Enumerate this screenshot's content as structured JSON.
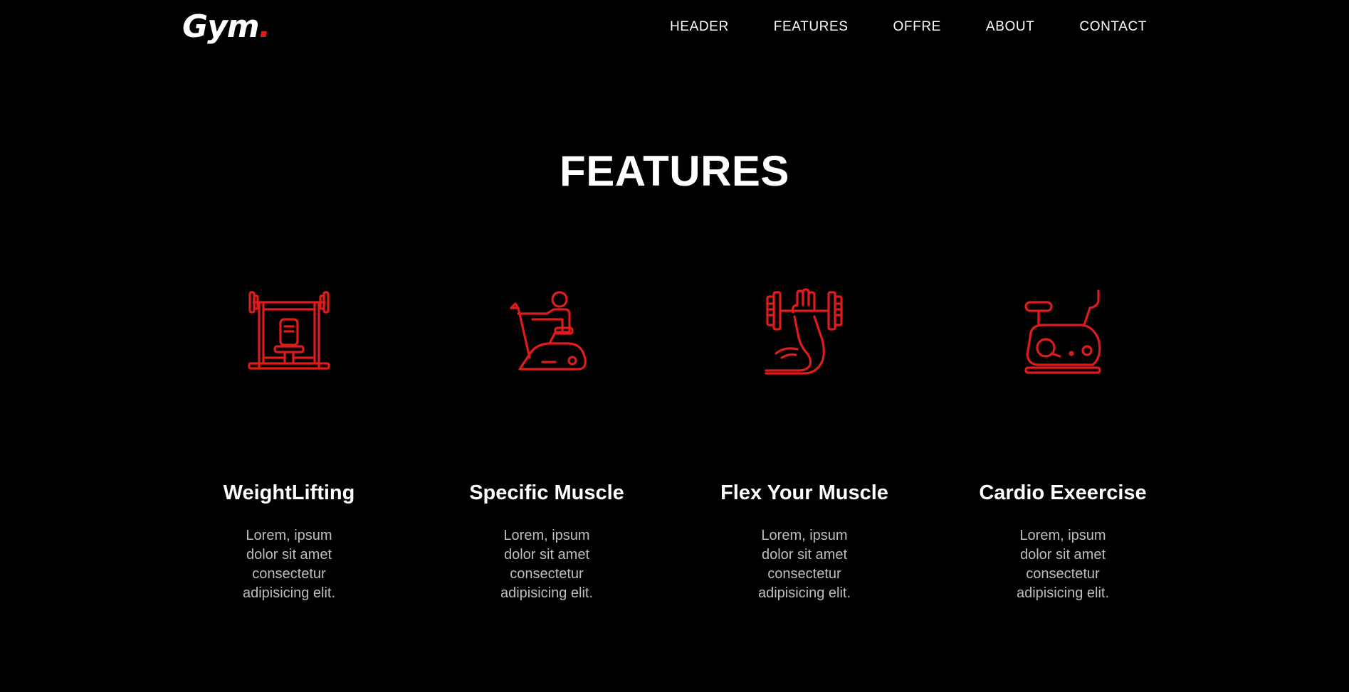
{
  "colors": {
    "background": "#000000",
    "accent": "#e01b1b",
    "text": "#ffffff",
    "muted_text": "#bdbdbd"
  },
  "brand": {
    "name": "Gym",
    "dot": "."
  },
  "nav": {
    "items": [
      {
        "label": "HEADER"
      },
      {
        "label": "FEATURES"
      },
      {
        "label": "OFFRE"
      },
      {
        "label": "ABOUT"
      },
      {
        "label": "CONTACT"
      }
    ]
  },
  "features": {
    "title": "FEATURES",
    "cards": [
      {
        "icon": "weight-bench-icon",
        "title": "WeightLifting",
        "text": "Lorem, ipsum dolor sit amet consectetur adipisicing elit."
      },
      {
        "icon": "exercise-bike-person-icon",
        "title": "Specific Muscle",
        "text": "Lorem, ipsum dolor sit amet consectetur adipisicing elit."
      },
      {
        "icon": "flexed-arm-dumbbell-icon",
        "title": "Flex Your Muscle",
        "text": "Lorem, ipsum dolor sit amet consectetur adipisicing elit."
      },
      {
        "icon": "stationary-bike-icon",
        "title": "Cardio Exeercise",
        "text": "Lorem, ipsum dolor sit amet consectetur adipisicing elit."
      }
    ]
  }
}
